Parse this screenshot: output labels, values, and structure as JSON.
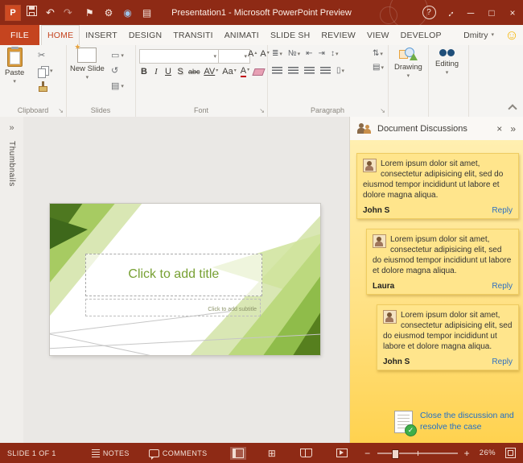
{
  "window": {
    "title": "Presentation1 - Microsoft PowerPoint Preview"
  },
  "titlebar_icons": {
    "logo": "P",
    "undo": "↶",
    "redo": "↷",
    "flag": "⚑",
    "gear": "⚙",
    "globe": "◉",
    "page": "▤",
    "help": "?",
    "expand": "↔",
    "minimize": "─",
    "maximize": "□",
    "close": "×"
  },
  "tabs": {
    "file": "FILE",
    "items": [
      "HOME",
      "INSERT",
      "DESIGN",
      "TRANSITI",
      "ANIMATI",
      "SLIDE SH",
      "REVIEW",
      "VIEW",
      "DEVELOP"
    ],
    "user": "Dmitry",
    "smiley": "☺"
  },
  "ui": {
    "caret": "▾"
  },
  "glyphs": {
    "cut": "✂",
    "layout": "▭",
    "reset": "↺",
    "section": "▤",
    "bullets": "≣",
    "numbering": "№",
    "indent_less": "⇤",
    "indent_more": "⇥",
    "line_spacing": "↕",
    "text_direction": "⇅",
    "align_text": "▤",
    "columns": "▯",
    "launcher": "↘",
    "sorter": "⊞",
    "grow": "▴",
    "shrink": "▾"
  },
  "ribbon": {
    "paste_label": "Paste",
    "new_slide_label": "New Slide",
    "drawing_label": "Drawing",
    "editing_label": "Editing",
    "font_name_value": "",
    "font_size_value": "",
    "controls": {
      "bold": "B",
      "italic": "I",
      "underline": "U",
      "shadow": "S",
      "strikethrough": "abc",
      "char_spacing": "AV",
      "change_case": "Aa",
      "grow_font": "A",
      "shrink_font": "A",
      "font_color": "A"
    },
    "group_labels": {
      "clipboard": "Clipboard",
      "slides": "Slides",
      "font": "Font",
      "paragraph": "Paragraph"
    }
  },
  "sidebar": {
    "label": "Thumbnails",
    "expand": "»"
  },
  "slide": {
    "title_placeholder": "Click to add title",
    "subtitle_placeholder": "Click to add subtitle"
  },
  "discussions": {
    "title": "Document Discussions",
    "close": "×",
    "more": "»",
    "check": "✓",
    "comments": [
      {
        "text": "Lorem ipsum dolor sit amet, consectetur adipisicing elit, sed do eiusmod tempor incididunt ut labore et dolore magna aliqua.",
        "author": "John S",
        "reply_label": "Reply"
      },
      {
        "text": "Lorem ipsum dolor sit amet, consectetur adipisicing elit, sed do eiusmod tempor incididunt ut labore et dolore magna aliqua.",
        "author": "Laura",
        "reply_label": "Reply"
      },
      {
        "text": "Lorem ipsum dolor sit amet, consectetur adipisicing elit, sed do eiusmod tempor incididunt ut labore et dolore magna aliqua.",
        "author": "John S",
        "reply_label": "Reply"
      }
    ],
    "resolve_label": "Close the discussion and resolve the case"
  },
  "statusbar": {
    "slide_info": "SLIDE 1 OF 1",
    "notes_label": "NOTES",
    "comments_label": "COMMENTS",
    "zoom_out": "−",
    "zoom_in": "+",
    "zoom_level": "26%"
  },
  "colors": {
    "titlebar": "#8E2A15",
    "accent_red": "#C5441F",
    "slide_title_green": "#77A033",
    "panel_top": "#FFEFB0",
    "panel_bottom": "#FFD24F",
    "card": "#FFE58C",
    "link_blue": "#2E6FC0"
  }
}
